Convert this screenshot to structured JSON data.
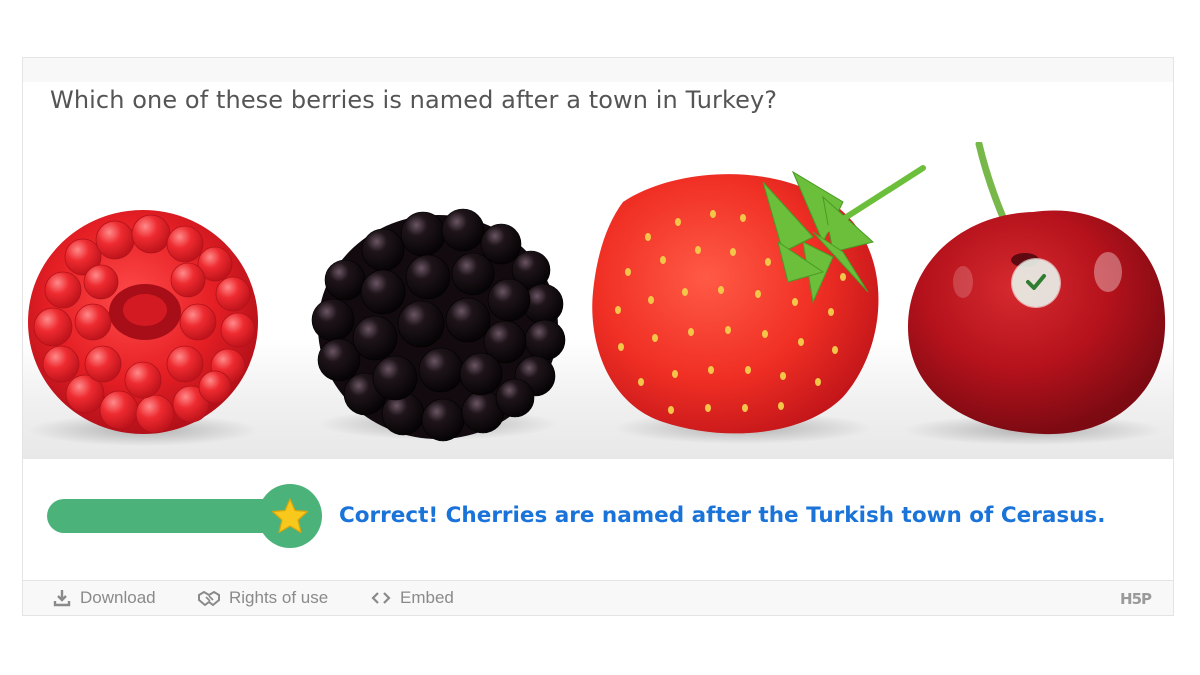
{
  "question": {
    "text": "Which one of these berries is named after a town in Turkey?"
  },
  "options": [
    {
      "name": "raspberry",
      "selected": false
    },
    {
      "name": "blackberry",
      "selected": false
    },
    {
      "name": "strawberry",
      "selected": false
    },
    {
      "name": "cherry",
      "selected": true,
      "correct": true
    }
  ],
  "result": {
    "score_fraction": 1.0,
    "feedback": "Correct! Cherries are named after the Turkish town of Cerasus."
  },
  "footer": {
    "download_label": "Download",
    "rights_label": "Rights of use",
    "embed_label": "Embed",
    "logo": "H5P"
  },
  "colors": {
    "score_green": "#4bb37a",
    "feedback_blue": "#1a73d9",
    "star_yellow": "#f8c81c",
    "check_green": "#2e7d32"
  },
  "icons": {
    "download": "download-icon",
    "rights": "handshake-icon",
    "embed": "code-icon",
    "star": "star-icon",
    "check": "checkmark-icon"
  }
}
